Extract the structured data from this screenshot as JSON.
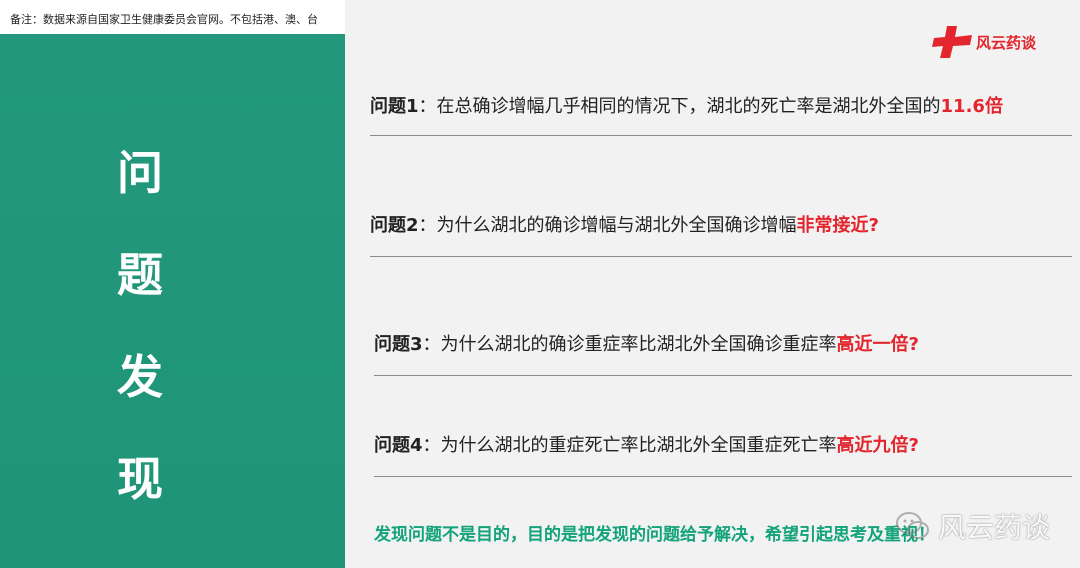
{
  "note": "备注：数据来源自国家卫生健康委员会官网。不包括港、澳、台",
  "title_chars": [
    "问",
    "题",
    "发",
    "现"
  ],
  "logo": {
    "text": "风云药谈",
    "icon": "red-cross-logo-icon"
  },
  "questions": [
    {
      "label": "问题1",
      "text": "：在总确诊增幅几乎相同的情况下，湖北的死亡率是湖北外全国的",
      "highlight": "11.6倍"
    },
    {
      "label": "问题2",
      "text": "：为什么湖北的确诊增幅与湖北外全国确诊增幅",
      "highlight": "非常接近?"
    },
    {
      "label": "问题3",
      "text": "：为什么湖北的确诊重症率比湖北外全国确诊重症率",
      "highlight": "高近一倍?"
    },
    {
      "label": "问题4",
      "text": "：为什么湖北的重症死亡率比湖北外全国重症死亡率",
      "highlight": "高近九倍?"
    }
  ],
  "conclusion": "发现问题不是目的，目的是把发现的问题给予解决，希望引起思考及重视！",
  "watermark": {
    "text": "风云药谈",
    "icon": "wechat-icon"
  },
  "colors": {
    "panel": "#23987c",
    "accent_red": "#e3262d",
    "conclusion_green": "#12a37a"
  }
}
